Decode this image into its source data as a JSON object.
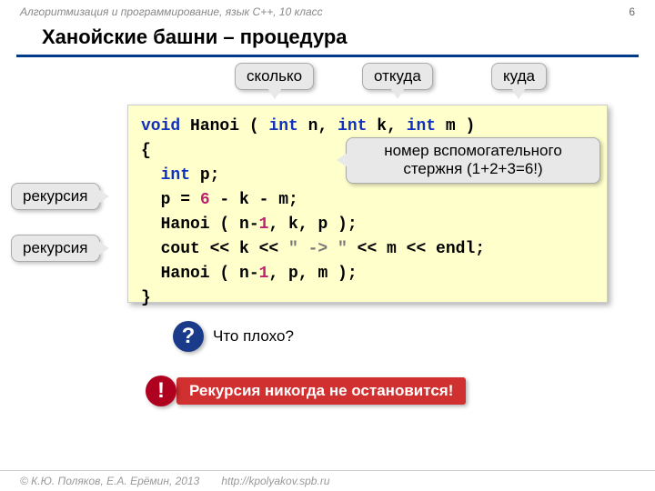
{
  "header": {
    "course": "Алгоритмизация и программирование, язык  C++, 10 класс",
    "page": "6"
  },
  "title": "Ханойские башни – процедура",
  "callouts": {
    "howmany": "сколько",
    "from": "откуда",
    "to": "куда",
    "recursion1": "рекурсия",
    "recursion2": "рекурсия",
    "aux": "номер вспомогательного стержня (1+2+3=6!)"
  },
  "code": {
    "l1_void": "void",
    "l1_name": " Hanoi ( ",
    "l1_intn": "int",
    "l1_n": " n, ",
    "l1_intk": "int",
    "l1_k": " k, ",
    "l1_intm": "int",
    "l1_m": " m )",
    "l2": "{",
    "l3_int": "int",
    "l3_p": " p;",
    "l4a": "  p = ",
    "l4_6": "6",
    "l4b": " - k - m;",
    "l5a": "  Hanoi ( n-",
    "l5_1": "1",
    "l5b": ", k, p );",
    "l6a": "  cout << k << ",
    "l6_str": "\" -> \"",
    "l6b": " << m << endl;",
    "l7a": "  Hanoi ( n-",
    "l7_1": "1",
    "l7b": ", p, m );",
    "l8": "}"
  },
  "question": {
    "icon": "?",
    "text": "Что плохо?"
  },
  "warning": {
    "icon": "!",
    "text": "Рекурсия никогда не остановится!"
  },
  "footer": {
    "copyright": "© К.Ю. Поляков, Е.А. Ерёмин, 2013",
    "url": "http://kpolyakov.spb.ru"
  }
}
